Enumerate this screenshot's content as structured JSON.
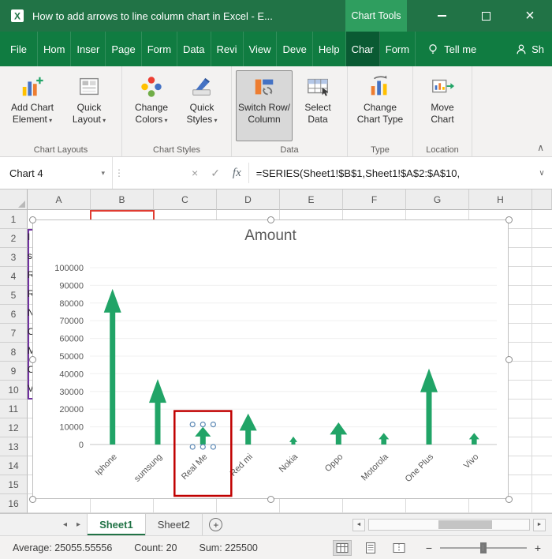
{
  "title_bar": {
    "title": "How to add arrows to line  column chart in Excel  -  E...",
    "contextual_tab_label": "Chart Tools"
  },
  "menu_bar": {
    "tabs": [
      {
        "label": "File",
        "active": false
      },
      {
        "label": "Hom",
        "active": false
      },
      {
        "label": "Inser",
        "active": false
      },
      {
        "label": "Page",
        "active": false
      },
      {
        "label": "Form",
        "active": false
      },
      {
        "label": "Data",
        "active": false
      },
      {
        "label": "Revi",
        "active": false
      },
      {
        "label": "View",
        "active": false
      },
      {
        "label": "Deve",
        "active": false
      },
      {
        "label": "Help",
        "active": false
      },
      {
        "label": "Char",
        "active": true
      },
      {
        "label": "Form",
        "active": false
      }
    ],
    "tell_me_label": "Tell me",
    "share_label": "Sh"
  },
  "ribbon": {
    "groups": [
      {
        "name": "Chart Layouts",
        "buttons": [
          {
            "label": "Add Chart Element",
            "icon": "add-chart-element",
            "dropdown": true,
            "active": false
          },
          {
            "label": "Quick Layout",
            "icon": "quick-layout",
            "dropdown": true,
            "active": false
          }
        ]
      },
      {
        "name": "Chart Styles",
        "buttons": [
          {
            "label": "Change Colors",
            "icon": "change-colors",
            "dropdown": true,
            "active": false,
            "narrow": true
          },
          {
            "label": "Quick Styles",
            "icon": "quick-styles",
            "dropdown": true,
            "active": false,
            "narrow": true
          }
        ]
      },
      {
        "name": "Data",
        "buttons": [
          {
            "label": "Switch Row/ Column",
            "icon": "switch-row-column",
            "dropdown": false,
            "active": true
          },
          {
            "label": "Select Data",
            "icon": "select-data",
            "dropdown": false,
            "active": false,
            "narrow": true
          }
        ]
      },
      {
        "name": "Type",
        "buttons": [
          {
            "label": "Change Chart Type",
            "icon": "change-chart-type",
            "dropdown": false,
            "active": false
          }
        ]
      },
      {
        "name": "Location",
        "buttons": [
          {
            "label": "Move Chart",
            "icon": "move-chart",
            "dropdown": false,
            "active": false,
            "narrow": true
          }
        ]
      }
    ]
  },
  "formula_bar": {
    "name_box_value": "Chart 4",
    "cancel_glyph": "×",
    "enter_glyph": "✓",
    "fx_label": "fx",
    "formula": "=SERIES(Sheet1!$B$1,Sheet1!$A$2:$A$10,"
  },
  "grid": {
    "column_headers": [
      "A",
      "B",
      "C",
      "D",
      "E",
      "F",
      "G",
      "H"
    ],
    "row_headers": [
      "1",
      "2",
      "3",
      "4",
      "5",
      "6",
      "7",
      "8",
      "9",
      "10",
      "11",
      "12",
      "13",
      "14",
      "15",
      "16"
    ],
    "partial_column_a_values": [
      "I",
      "s",
      "R",
      "R",
      "N",
      "O",
      "M",
      "O",
      "V"
    ]
  },
  "chart_data": {
    "type": "bar",
    "subtype": "up-arrow-columns",
    "title": "Amount",
    "categories": [
      "Iphone",
      "sumsung",
      "Real Me",
      "Red mi",
      "Nokia",
      "Oppo",
      "Motorola",
      "One Plus",
      "Vivo"
    ],
    "values": [
      88000,
      37000,
      10000,
      17500,
      4500,
      12500,
      6500,
      43000,
      6500
    ],
    "ylim": [
      0,
      100000
    ],
    "ytick_step": 10000,
    "series_color": "#21A467",
    "axis_text_color": "#595959",
    "selected_category": "Real Me",
    "selection_box_color": "#C00000",
    "legend": "none",
    "gridlines": true
  },
  "sheet_tabs": {
    "tabs": [
      {
        "label": "Sheet1",
        "active": true
      },
      {
        "label": "Sheet2",
        "active": false
      }
    ],
    "add_sheet_glyph": "+"
  },
  "status_bar": {
    "average": "Average: 25055.55556",
    "count": "Count: 20",
    "sum": "Sum: 225500",
    "zoom_percent": 50
  },
  "colors": {
    "title_bar_green": "#217346",
    "menu_bar_green": "#107C41",
    "active_tab_green": "#0A5A33",
    "contextual_tab_green": "#2F9E5F",
    "series_green": "#21A467",
    "selection_red": "#C00000"
  }
}
